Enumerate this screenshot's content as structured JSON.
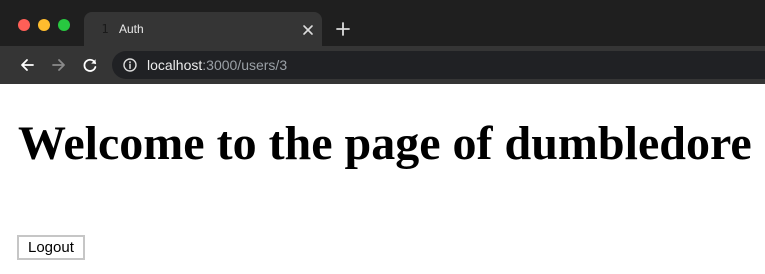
{
  "window": {
    "controls": [
      "close",
      "minimize",
      "zoom"
    ],
    "colors": {
      "close": "#fe5f57",
      "minimize": "#febc2e",
      "zoom": "#28c840"
    }
  },
  "tab": {
    "favicon": "1",
    "title": "Auth",
    "close_icon": "close-icon"
  },
  "new_tab_icon": "plus-icon",
  "toolbar": {
    "back_icon": "arrow-left-icon",
    "forward_icon": "arrow-right-icon",
    "reload_icon": "reload-icon",
    "info_icon": "info-icon",
    "url_host": "localhost",
    "url_rest": ":3000/users/3"
  },
  "page": {
    "heading": "Welcome to the page of dumbledore",
    "logout_label": "Logout"
  }
}
